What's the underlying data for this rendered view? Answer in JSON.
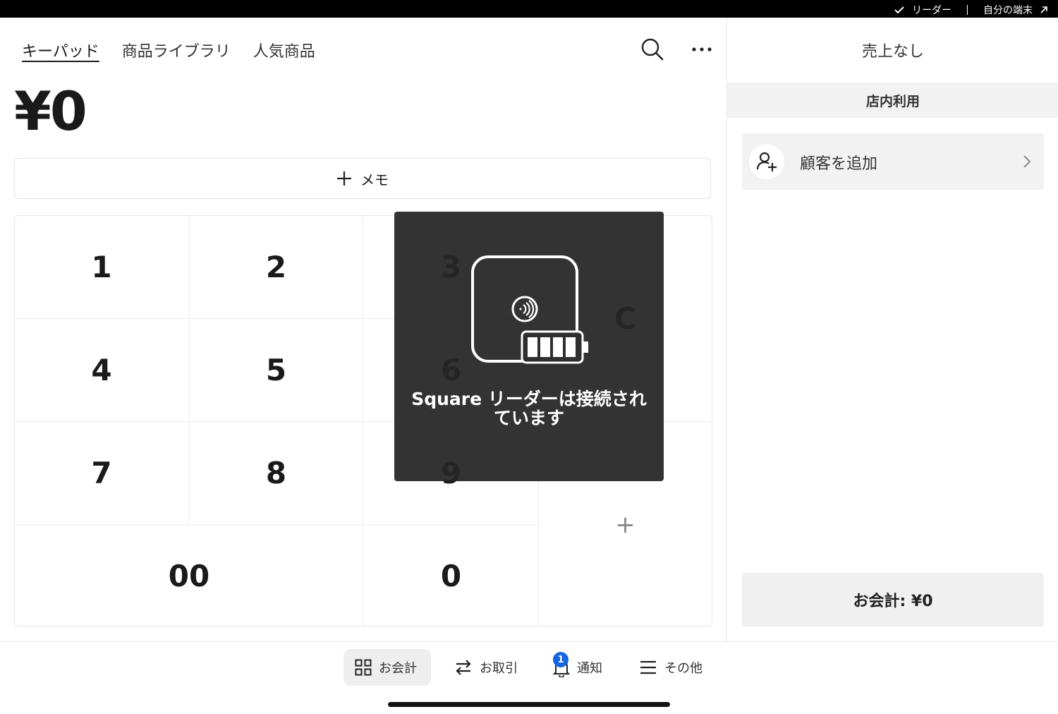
{
  "status_bar": {
    "reader_label": "リーダー",
    "device_label": "自分の端末"
  },
  "tabs": [
    {
      "label": "キーパッド",
      "active": true
    },
    {
      "label": "商品ライブラリ",
      "active": false
    },
    {
      "label": "人気商品",
      "active": false
    }
  ],
  "icons": {
    "search": "search-icon",
    "more": "more-icon"
  },
  "amount": "¥0",
  "memo": {
    "plus": "+",
    "label": "メモ"
  },
  "keypad": {
    "keys": [
      "1",
      "2",
      "3",
      "4",
      "5",
      "6",
      "7",
      "8",
      "9",
      "00",
      "0"
    ],
    "clear": "C",
    "add": "+"
  },
  "overlay": {
    "message_line1": "Square リーダーは接続され",
    "message_line2": "ています"
  },
  "right_panel": {
    "title": "売上なし",
    "dining_option": "店内利用",
    "add_customer": "顧客を追加",
    "checkout": "お会計: ¥0"
  },
  "bottom_nav": [
    {
      "label": "お会計",
      "icon": "grid-icon",
      "active": true
    },
    {
      "label": "お取引",
      "icon": "swap-icon",
      "active": false
    },
    {
      "label": "通知",
      "icon": "bell-icon",
      "active": false,
      "badge": "1"
    },
    {
      "label": "その他",
      "icon": "menu-icon",
      "active": false
    }
  ],
  "colors": {
    "badge": "#1565e0",
    "overlay": "#2f2f2f"
  }
}
